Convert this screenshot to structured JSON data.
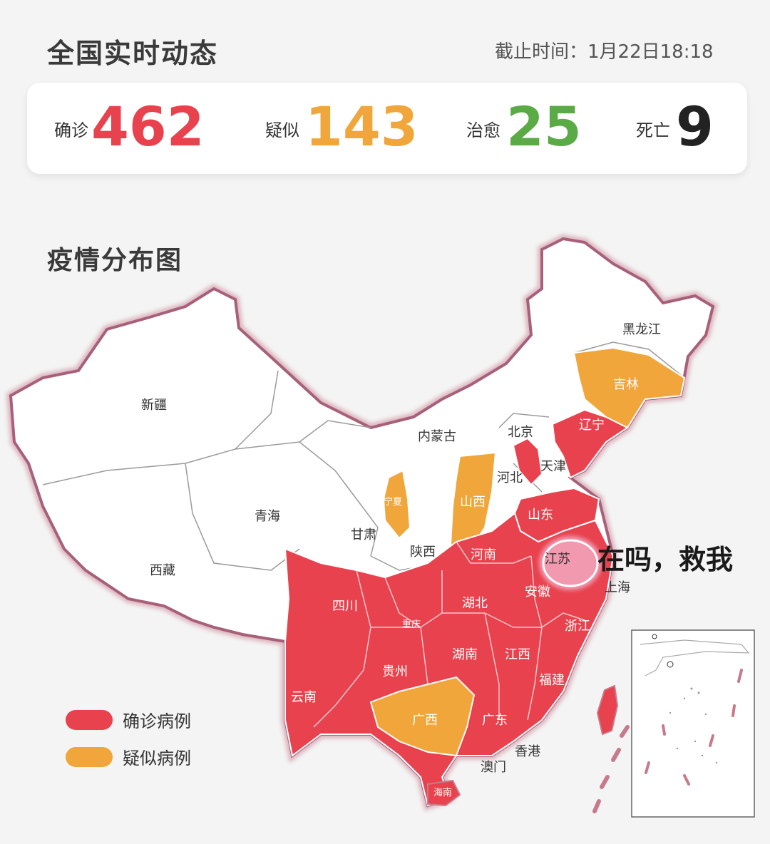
{
  "header": {
    "title": "全国实时动态",
    "deadline": "截止时间：1月22日18:18"
  },
  "stats": [
    {
      "label": "确诊",
      "value": "462",
      "color": "#e8424e"
    },
    {
      "label": "疑似",
      "value": "143",
      "color": "#f0a63a"
    },
    {
      "label": "治愈",
      "value": "25",
      "color": "#5aaa45"
    },
    {
      "label": "死亡",
      "value": "9",
      "color": "#222222"
    }
  ],
  "map": {
    "title": "疫情分布图",
    "colors": {
      "confirmed": "#e8424e",
      "suspected": "#f0a63a",
      "none": "#ffffff",
      "border": "#b06a7a"
    },
    "provinces": [
      {
        "name": "新疆",
        "status": "none"
      },
      {
        "name": "西藏",
        "status": "none"
      },
      {
        "name": "青海",
        "status": "none"
      },
      {
        "name": "甘肃",
        "status": "none"
      },
      {
        "name": "内蒙古",
        "status": "none"
      },
      {
        "name": "黑龙江",
        "status": "none"
      },
      {
        "name": "吉林",
        "status": "suspected"
      },
      {
        "name": "辽宁",
        "status": "confirmed"
      },
      {
        "name": "北京",
        "status": "confirmed"
      },
      {
        "name": "天津",
        "status": "confirmed"
      },
      {
        "name": "河北",
        "status": "none"
      },
      {
        "name": "山西",
        "status": "suspected"
      },
      {
        "name": "宁夏",
        "status": "suspected"
      },
      {
        "name": "陕西",
        "status": "none"
      },
      {
        "name": "山东",
        "status": "confirmed"
      },
      {
        "name": "河南",
        "status": "confirmed"
      },
      {
        "name": "江苏",
        "status": "confirmed"
      },
      {
        "name": "上海",
        "status": "confirmed"
      },
      {
        "name": "安徽",
        "status": "confirmed"
      },
      {
        "name": "湖北",
        "status": "confirmed"
      },
      {
        "name": "四川",
        "status": "confirmed"
      },
      {
        "name": "重庆",
        "status": "confirmed"
      },
      {
        "name": "浙江",
        "status": "confirmed"
      },
      {
        "name": "贵州",
        "status": "confirmed"
      },
      {
        "name": "湖南",
        "status": "confirmed"
      },
      {
        "name": "江西",
        "status": "confirmed"
      },
      {
        "name": "福建",
        "status": "confirmed"
      },
      {
        "name": "云南",
        "status": "confirmed"
      },
      {
        "name": "广西",
        "status": "suspected"
      },
      {
        "name": "广东",
        "status": "confirmed"
      },
      {
        "name": "香港",
        "status": "none"
      },
      {
        "name": "澳门",
        "status": "none"
      },
      {
        "name": "海南",
        "status": "confirmed"
      },
      {
        "name": "台湾",
        "status": "confirmed"
      }
    ]
  },
  "legend": [
    {
      "label": "确诊病例",
      "color": "#e8424e"
    },
    {
      "label": "疑似病例",
      "color": "#f0a63a"
    }
  ],
  "overlay": {
    "text": "在吗，救我"
  }
}
